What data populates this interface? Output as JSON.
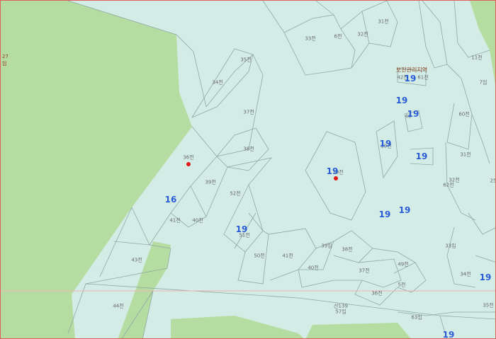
{
  "colors": {
    "background": "#d3ece6",
    "forest": "#b5dda2",
    "parcel_line": "#8ea8a2",
    "marker": "#e01818",
    "number": "#2a5bd6",
    "zone": "#8a3a1a"
  },
  "zone_label": "보전관리지역",
  "edge_labels": [
    "27",
    "임"
  ],
  "parcels": [
    "35전",
    "34전",
    "37전",
    "38전",
    "36전",
    "39전",
    "52전",
    "41전",
    "40전",
    "51전",
    "50전",
    "41전",
    "39임",
    "38전",
    "40전",
    "37전",
    "49전",
    "5전",
    "36전",
    "33전",
    "6전",
    "32전",
    "31전",
    "11전",
    "42전",
    "61전",
    "7임",
    "60전",
    "40",
    "31전",
    "62전",
    "32전",
    "25",
    "33임",
    "34전",
    "35전",
    "63임",
    "43전",
    "44전",
    "산139",
    "57임",
    "39전",
    "19전"
  ],
  "numbers": [
    "19",
    "19",
    "19",
    "19",
    "19",
    "16",
    "19",
    "19",
    "19",
    "19",
    "19",
    "19"
  ]
}
